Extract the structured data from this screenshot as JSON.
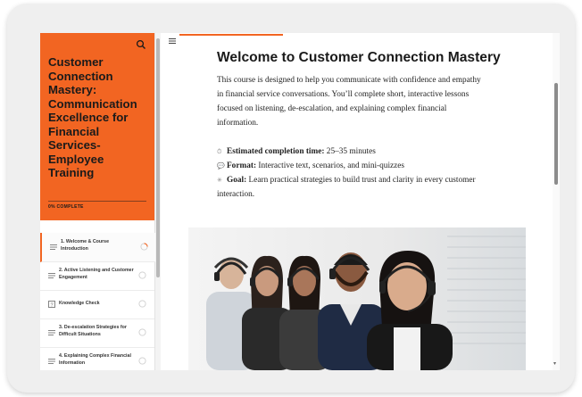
{
  "sidebar": {
    "course_title": "Customer Connection Mastery: Communication Excellence for Financial Services- Employee Training",
    "progress_text": "0% COMPLETE",
    "search_icon": "search-icon",
    "lessons": [
      {
        "label": "1. Welcome & Course Introduction",
        "icon": "text-lines-icon",
        "status": "in-progress"
      },
      {
        "label": "2. Active Listening and Customer Engagement",
        "icon": "text-lines-icon",
        "status": "not-started"
      },
      {
        "label": "Knowledge Check",
        "icon": "quiz-icon",
        "status": "not-started"
      },
      {
        "label": "3. De-escalation Strategies for Difficult Situations",
        "icon": "text-lines-icon",
        "status": "not-started"
      },
      {
        "label": "4. Explaining Complex Financial Information",
        "icon": "text-lines-icon",
        "status": "not-started"
      }
    ]
  },
  "content": {
    "title": "Welcome to Customer Connection Mastery",
    "intro": "This course is designed to help you communicate with confidence and empathy in financial service conversations. You’ll complete short, interactive lessons focused on listening, de-escalation, and explaining complex financial information.",
    "details": [
      {
        "icon": "stopwatch-icon",
        "label": "Estimated completion time:",
        "value": " 25–35 minutes"
      },
      {
        "icon": "speech-bubble-icon",
        "label": "Format:",
        "value": " Interactive text, scenarios, and mini-quizzes"
      },
      {
        "icon": "sparkle-icon",
        "label": "Goal:",
        "value": " Learn practical strategies to build trust and clarity in every customer interaction."
      }
    ]
  },
  "colors": {
    "accent": "#f26522",
    "text": "#1a1a1a"
  }
}
